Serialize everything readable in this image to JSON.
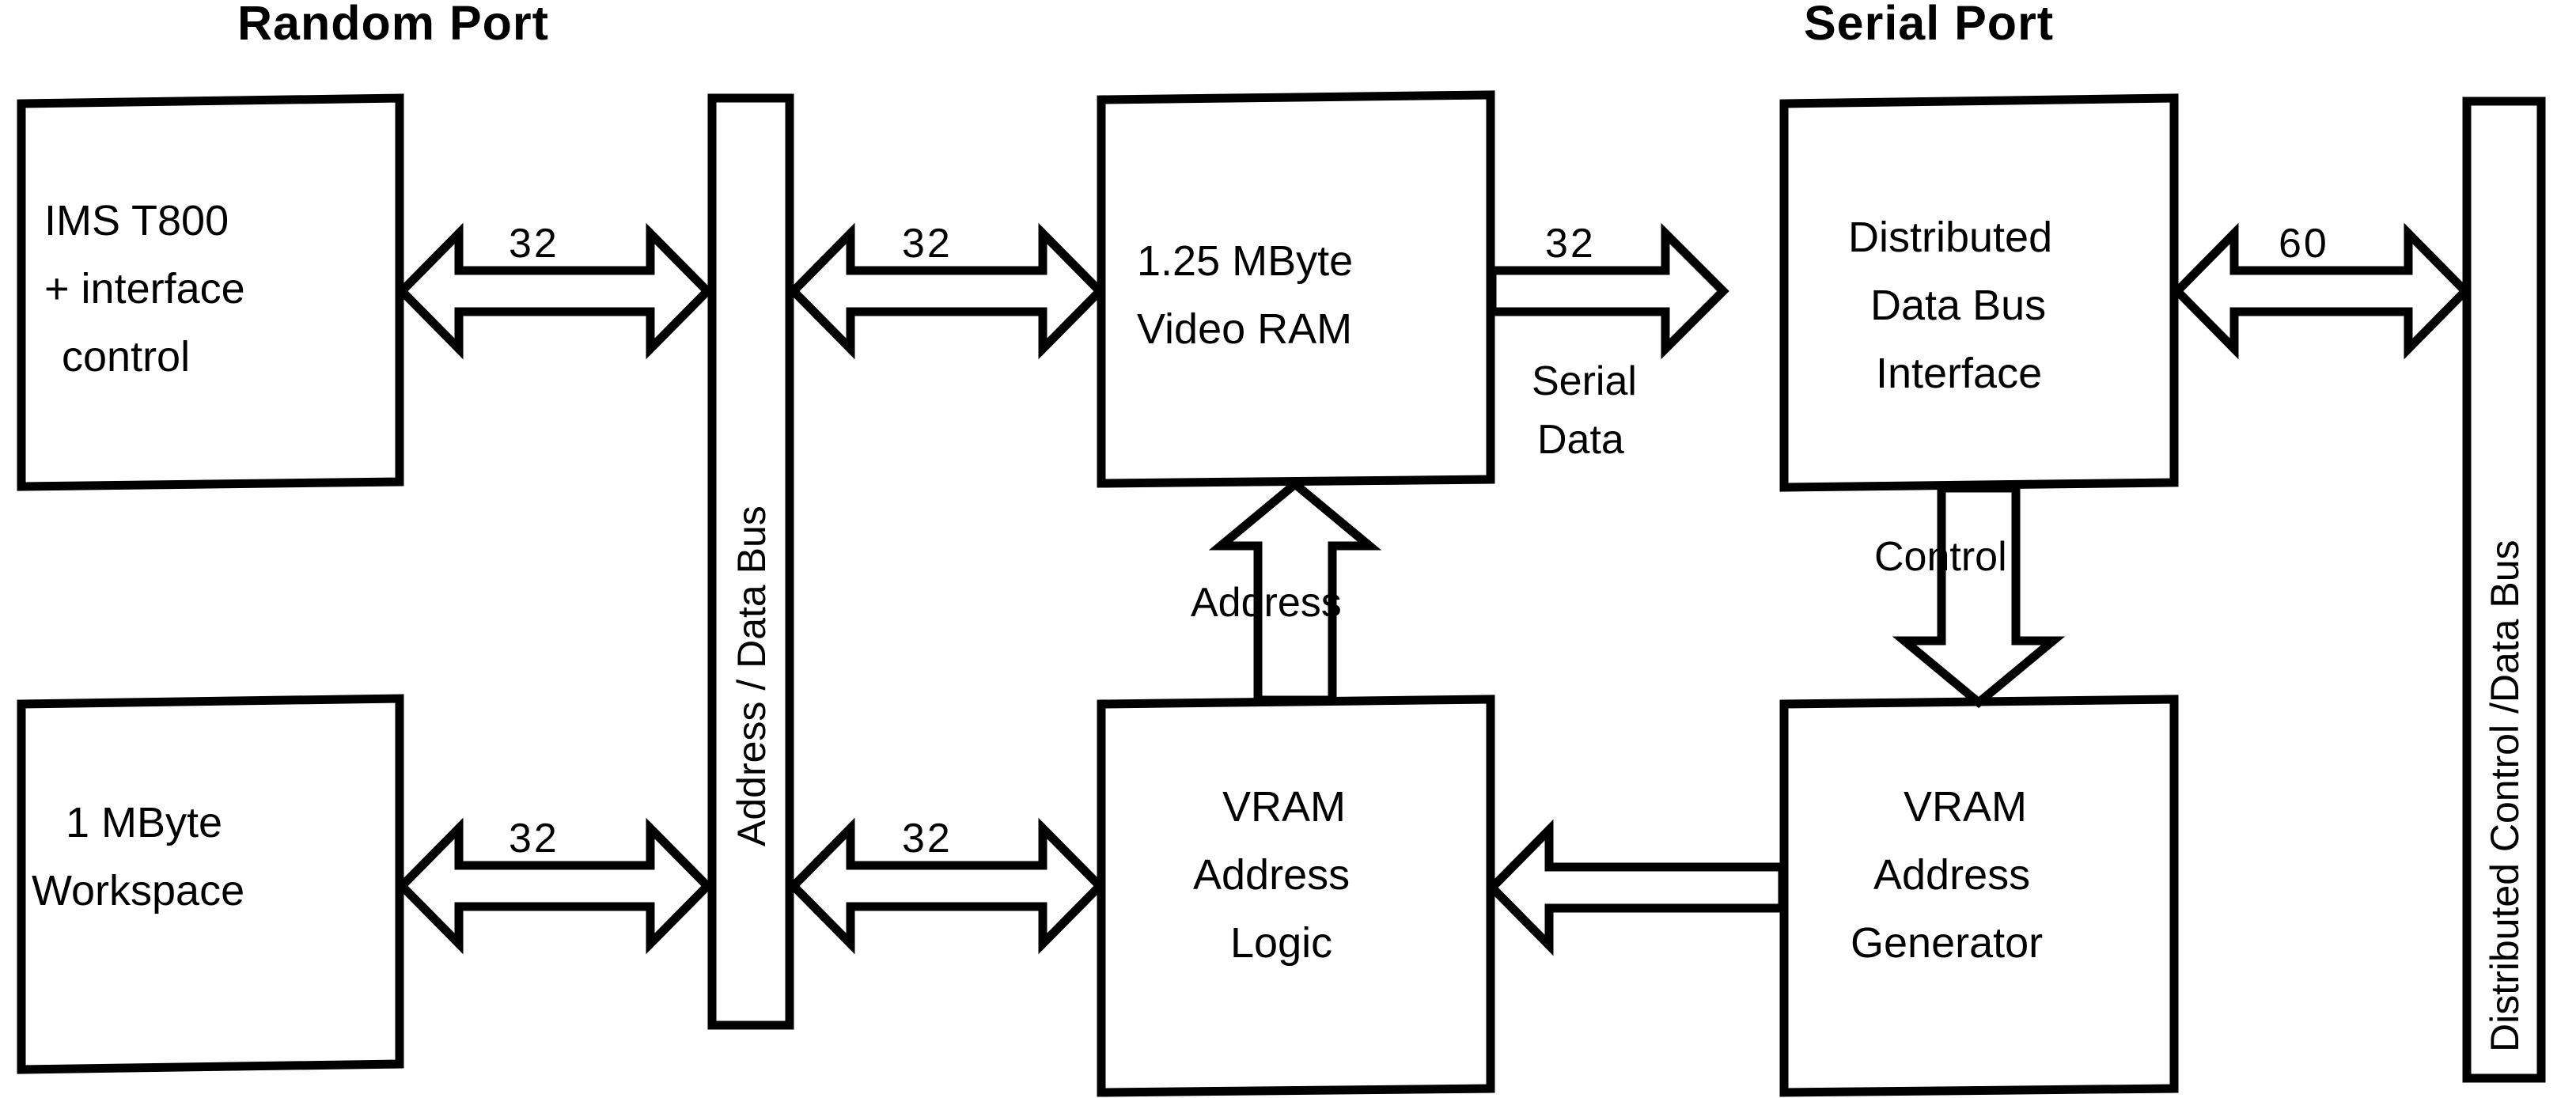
{
  "diagram": {
    "title": "IMS T800 / Video RAM block diagram",
    "background_color": "#ffffff",
    "line_color": "#000000",
    "titles": {
      "random_port": "Random  Port",
      "serial_port": "Serial  Port"
    },
    "blocks": [
      {
        "id": "ims-t800",
        "lines": [
          "IMS   T800",
          "+ interface",
          "control"
        ]
      },
      {
        "id": "workspace",
        "lines": [
          "1  MByte",
          "Workspace"
        ]
      },
      {
        "id": "video-ram",
        "lines": [
          "1.25   MByte",
          "Video   RAM"
        ]
      },
      {
        "id": "vram-address-logic",
        "lines": [
          "VRAM",
          "Address",
          "Logic"
        ]
      },
      {
        "id": "distributed-data-bus-interface",
        "lines": [
          "Distributed",
          "Data  Bus",
          "Interface"
        ]
      },
      {
        "id": "vram-address-generator",
        "lines": [
          "VRAM",
          "Address",
          "Generator"
        ]
      }
    ],
    "buses": [
      {
        "id": "address-data-bus",
        "label": "Address / Data  Bus"
      },
      {
        "id": "distributed-control-data-bus",
        "label": "Distributed  Control  /Data  Bus"
      }
    ],
    "connections": [
      {
        "id": "t800-to-bus",
        "label": "32",
        "kind": "bidirectional",
        "orientation": "horizontal"
      },
      {
        "id": "bus-to-vram",
        "label": "32",
        "kind": "bidirectional",
        "orientation": "horizontal"
      },
      {
        "id": "vram-to-interface",
        "label": "32",
        "kind": "unidirectional-right",
        "orientation": "horizontal"
      },
      {
        "id": "serial-data",
        "label": "Serial\nData",
        "kind": "annotation",
        "orientation": "horizontal"
      },
      {
        "id": "interface-to-dcdb",
        "label": "60",
        "kind": "bidirectional",
        "orientation": "horizontal"
      },
      {
        "id": "workspace-to-bus",
        "label": "32",
        "kind": "bidirectional",
        "orientation": "horizontal"
      },
      {
        "id": "bus-to-val",
        "label": "32",
        "kind": "bidirectional",
        "orientation": "horizontal"
      },
      {
        "id": "val-to-vram",
        "label": "Address",
        "kind": "unidirectional-up",
        "orientation": "vertical"
      },
      {
        "id": "ddbi-to-vag",
        "label": "Control",
        "kind": "unidirectional-down",
        "orientation": "vertical"
      },
      {
        "id": "vag-to-val",
        "label": "",
        "kind": "unidirectional-left",
        "orientation": "horizontal"
      }
    ],
    "edge_labels": {
      "w32_a": "32",
      "w32_b": "32",
      "w32_c": "32",
      "w32_d": "32",
      "w32_e": "32",
      "w60": "60",
      "serial_data_l1": "Serial",
      "serial_data_l2": "Data",
      "address": "Address",
      "control": "Control"
    }
  }
}
